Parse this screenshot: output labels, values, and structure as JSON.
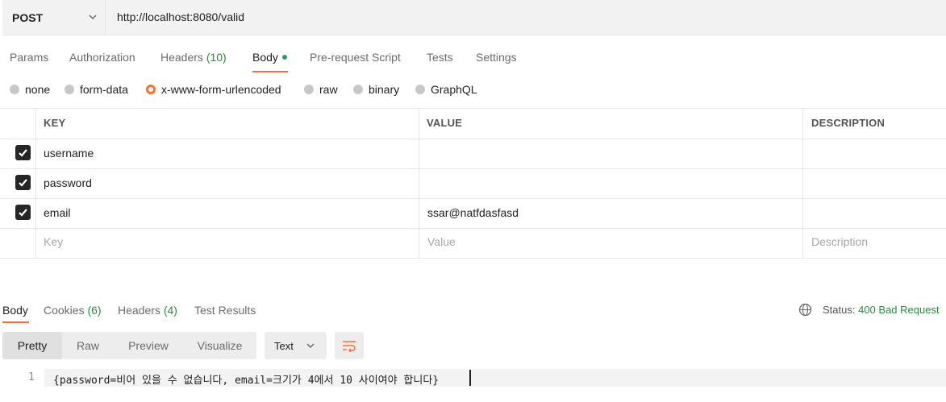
{
  "request": {
    "method": "POST",
    "url": "http://localhost:8080/valid"
  },
  "request_tabs": [
    {
      "label": "Params"
    },
    {
      "label": "Authorization"
    },
    {
      "label": "Headers",
      "count": "(10)"
    },
    {
      "label": "Body",
      "active": true
    },
    {
      "label": "Pre-request Script"
    },
    {
      "label": "Tests"
    },
    {
      "label": "Settings"
    }
  ],
  "body_types": [
    {
      "label": "none"
    },
    {
      "label": "form-data"
    },
    {
      "label": "x-www-form-urlencoded",
      "selected": true
    },
    {
      "label": "raw"
    },
    {
      "label": "binary"
    },
    {
      "label": "GraphQL"
    }
  ],
  "params_table": {
    "headers": {
      "key": "KEY",
      "value": "VALUE",
      "description": "DESCRIPTION"
    },
    "rows": [
      {
        "checked": true,
        "key": "username",
        "value": "",
        "description": ""
      },
      {
        "checked": true,
        "key": "password",
        "value": "",
        "description": ""
      },
      {
        "checked": true,
        "key": "email",
        "value": "ssar@natfdasfasd",
        "description": ""
      }
    ],
    "placeholders": {
      "key": "Key",
      "value": "Value",
      "description": "Description"
    }
  },
  "response": {
    "tabs": [
      {
        "label": "Body",
        "active": true
      },
      {
        "label": "Cookies",
        "count": "(6)"
      },
      {
        "label": "Headers",
        "count": "(4)"
      },
      {
        "label": "Test Results"
      }
    ],
    "status_label": "Status:",
    "status_value": "400 Bad Request",
    "view_modes": [
      "Pretty",
      "Raw",
      "Preview",
      "Visualize"
    ],
    "active_view": "Pretty",
    "format": "Text",
    "line_number": "1",
    "body_line": "{password=비어 있을 수 없습니다, email=크기가 4에서 10 사이여야 합니다}"
  },
  "colors": {
    "accent": "#ff6c37",
    "status_error": "#2d8a3e",
    "body_dot": "#1fa05a"
  },
  "icons": [
    "chevron-down-icon",
    "globe-icon",
    "wrap-lines-icon",
    "checkmark-icon"
  ]
}
